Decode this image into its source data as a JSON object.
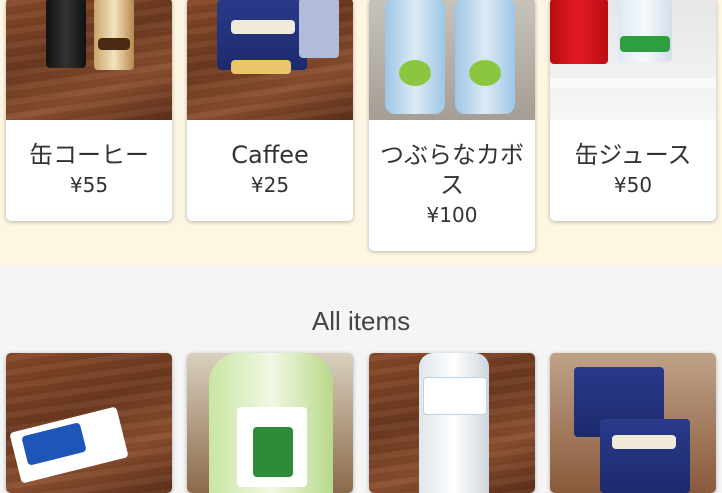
{
  "featured": [
    {
      "name": "缶コーヒー",
      "price": "¥55"
    },
    {
      "name": "Caffee",
      "price": "¥25"
    },
    {
      "name": "つぶらなカボス",
      "price": "¥100"
    },
    {
      "name": "缶ジュース",
      "price": "¥50"
    }
  ],
  "all_items": {
    "title": "All items"
  },
  "colors": {
    "top_band": "#fdf6e3",
    "page_bg": "#f5f5f5",
    "card_bg": "#ffffff",
    "text": "#333333"
  }
}
